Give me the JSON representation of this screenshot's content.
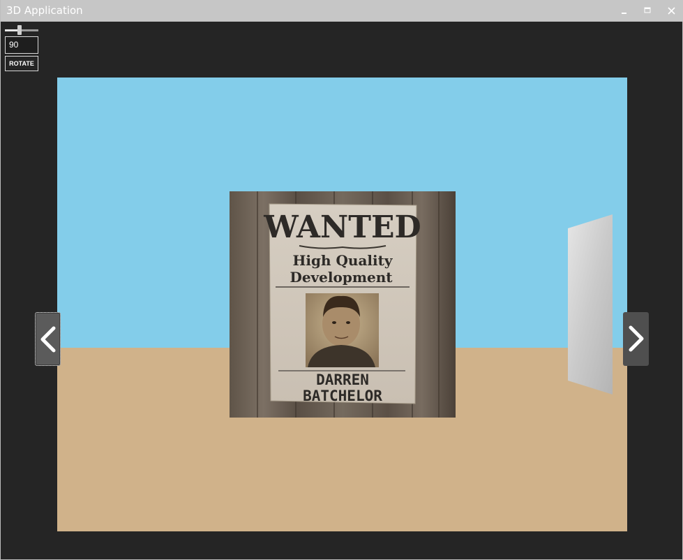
{
  "window": {
    "title": "3D Application",
    "minimize_glyph": "🗕",
    "maximize_glyph": "🗖",
    "close_glyph": "✕"
  },
  "controls": {
    "slider_value": 90,
    "value_text": "90",
    "rotate_label": "ROTATE"
  },
  "scene": {
    "sky_color": "#83cdea",
    "ground_color": "#d0b28a",
    "poster": {
      "headline": "WANTED",
      "line1": "High Quality",
      "line2": "Development",
      "name_line1": "DARREN",
      "name_line2": "BATCHELOR"
    }
  },
  "navigation": {
    "prev_icon": "chevron-left-icon",
    "next_icon": "chevron-right-icon"
  }
}
